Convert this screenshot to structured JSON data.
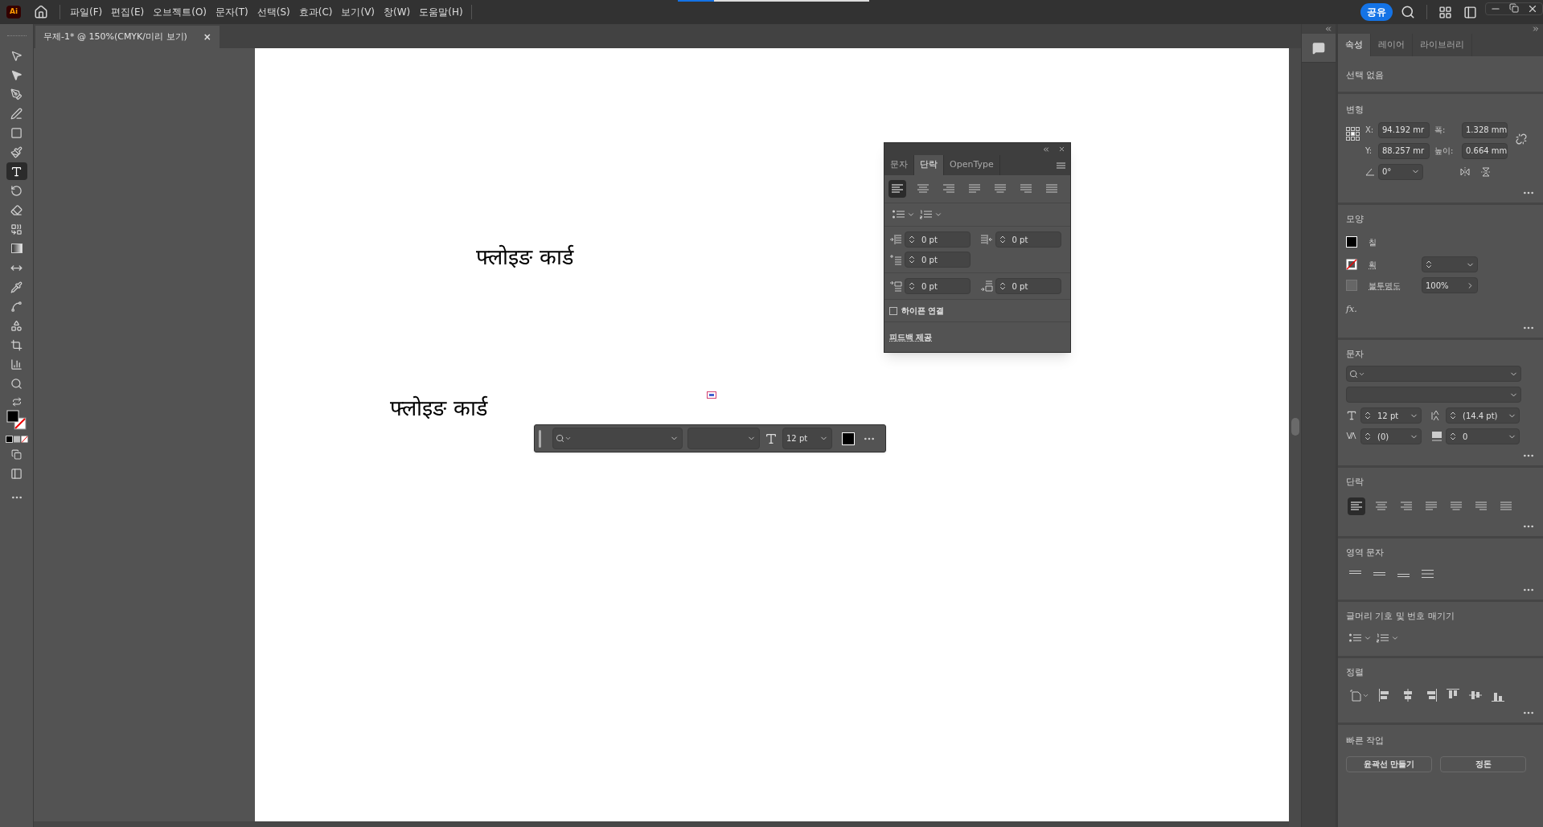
{
  "app_icon": "Ai",
  "menu": [
    "파일(F)",
    "편집(E)",
    "오브젝트(O)",
    "문자(T)",
    "선택(S)",
    "효과(C)",
    "보기(V)",
    "창(W)",
    "도움말(H)"
  ],
  "share_button": "공유",
  "document_tab": {
    "title": "무제-1* @ 150%(CMYK/미리 보기)",
    "close": "×"
  },
  "tools": [
    {
      "kind": "select",
      "selected": false
    },
    {
      "kind": "direct",
      "selected": false
    },
    {
      "kind": "pen",
      "selected": false
    },
    {
      "kind": "curvature",
      "selected": false
    },
    {
      "kind": "rect",
      "selected": false
    },
    {
      "kind": "brush",
      "selected": false
    },
    {
      "kind": "type",
      "selected": true
    },
    {
      "kind": "rotate",
      "selected": false
    },
    {
      "kind": "eraser",
      "selected": false
    },
    {
      "kind": "shapebuilder",
      "selected": false
    },
    {
      "kind": "gradient",
      "selected": false
    },
    {
      "kind": "width",
      "selected": false
    },
    {
      "kind": "eyedropper",
      "selected": false
    },
    {
      "kind": "puppet",
      "selected": false
    },
    {
      "kind": "blend",
      "selected": false
    },
    {
      "kind": "artboard",
      "selected": false
    },
    {
      "kind": "graph",
      "selected": false
    },
    {
      "kind": "zoom",
      "selected": false
    }
  ],
  "canvas_texts": [
    "फ्लोइङ कार्ड",
    "फ्लोइङ कार्ड"
  ],
  "paragraph_panel": {
    "tabs": [
      {
        "label": "문자",
        "selected": false
      },
      {
        "label": "단락",
        "selected": true
      },
      {
        "label": "OpenType",
        "selected": false
      }
    ],
    "alignments": [
      {
        "selected": true
      },
      {
        "selected": false
      },
      {
        "selected": false
      },
      {
        "selected": false
      },
      {
        "selected": false
      },
      {
        "selected": false
      },
      {
        "selected": false
      }
    ],
    "indent_fields": [
      "0 pt",
      "0 pt",
      "0 pt",
      "0 pt",
      "0 pt"
    ],
    "hyphenate": {
      "label": "하이픈 연결",
      "checked": false
    },
    "feedback_link": "피드백 제공"
  },
  "floating_toolbar": {
    "font_size": "12 pt"
  },
  "properties": {
    "tabs": [
      {
        "label": "속성",
        "selected": true
      },
      {
        "label": "레이어",
        "selected": false
      },
      {
        "label": "라이브러리",
        "selected": false
      }
    ],
    "selection": "선택 없음",
    "transform": {
      "title": "변형",
      "x_label": "X:",
      "x": "94.192 mr",
      "y_label": "Y:",
      "y": "88.257 mr",
      "w_label": "폭:",
      "w": "1.328 mm",
      "h_label": "높이:",
      "h": "0.664 mm",
      "angle": "0°"
    },
    "appearance": {
      "title": "모양",
      "fill_label": "칠",
      "stroke_label": "획",
      "opacity_label": "불투명도",
      "opacity": "100%",
      "fx": "fx."
    },
    "character": {
      "title": "문자",
      "size": "12 pt",
      "leading": "(14.4 pt)",
      "kerning": "(0)",
      "tracking": "0"
    },
    "paragraph": {
      "title": "단락",
      "alignments": [
        {
          "selected": true
        },
        {
          "selected": false
        },
        {
          "selected": false
        },
        {
          "selected": false
        },
        {
          "selected": false
        },
        {
          "selected": false
        },
        {
          "selected": false
        }
      ]
    },
    "area_type": {
      "title": "영역 문자"
    },
    "bullets": {
      "title": "글머리 기호 및 번호 매기기"
    },
    "align": {
      "title": "정렬"
    },
    "quick_actions": {
      "title": "빠른 작업",
      "buttons": [
        "윤곽선 만들기",
        "정돈"
      ]
    }
  }
}
